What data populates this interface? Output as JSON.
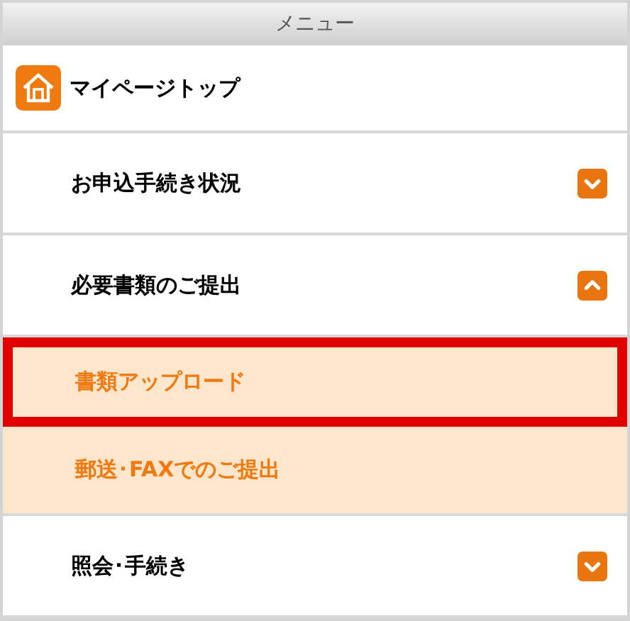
{
  "header": {
    "title": "メニュー"
  },
  "menu": [
    {
      "kind": "home",
      "label": "マイページトップ"
    },
    {
      "kind": "section",
      "label": "お申込手続き状況",
      "expanded": false
    },
    {
      "kind": "section",
      "label": "必要書類のご提出",
      "expanded": true,
      "children": [
        {
          "label": "書類アップロード",
          "highlighted": true
        },
        {
          "label": "郵送･FAXでのご提出",
          "highlighted": false
        }
      ]
    },
    {
      "kind": "section",
      "label": "照会･手続き",
      "expanded": false
    }
  ]
}
